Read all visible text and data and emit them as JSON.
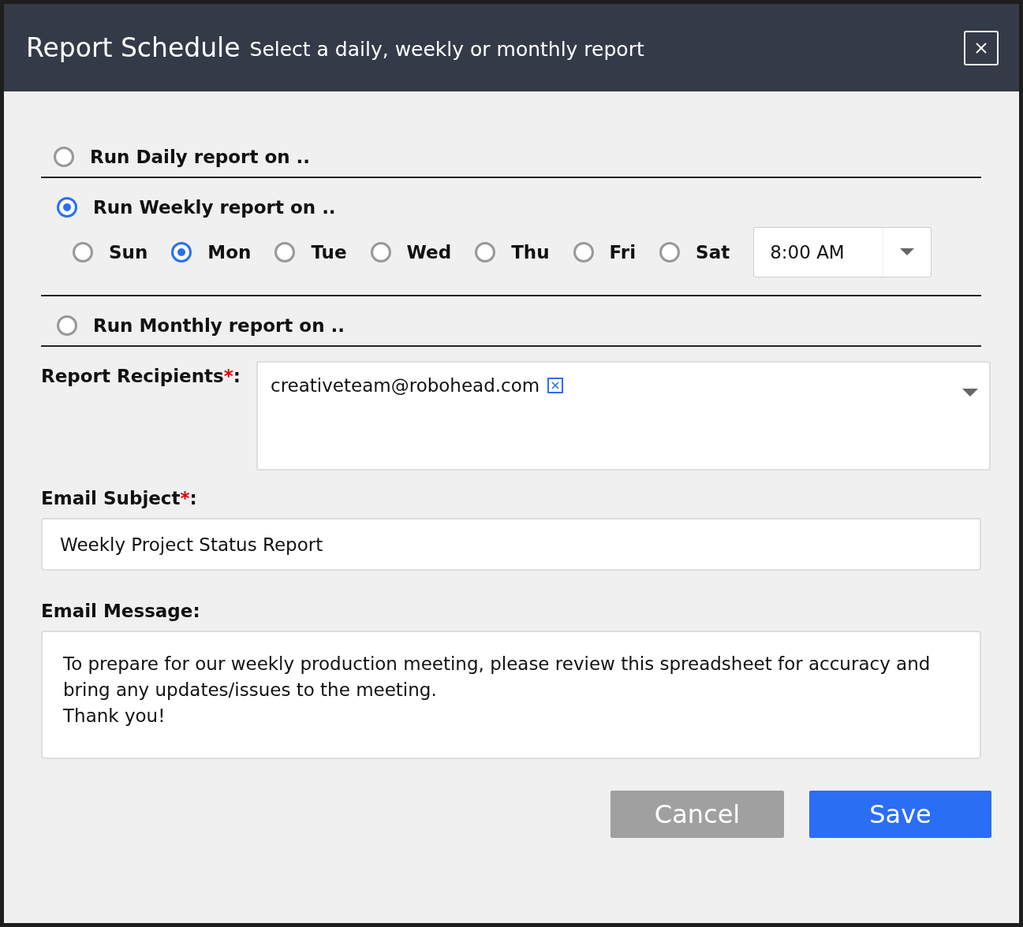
{
  "dialog": {
    "title": "Report Schedule",
    "subtitle": "Select a daily, weekly or monthly report"
  },
  "schedule_options": [
    {
      "label": "Run Daily report on ..",
      "selected": false
    },
    {
      "label": "Run Weekly report on ..",
      "selected": true,
      "days": [
        {
          "label": "Sun",
          "selected": false
        },
        {
          "label": "Mon",
          "selected": true
        },
        {
          "label": "Tue",
          "selected": false
        },
        {
          "label": "Wed",
          "selected": false
        },
        {
          "label": "Thu",
          "selected": false
        },
        {
          "label": "Fri",
          "selected": false
        },
        {
          "label": "Sat",
          "selected": false
        }
      ],
      "time": "8:00 AM"
    },
    {
      "label": "Run Monthly report on ..",
      "selected": false
    }
  ],
  "recipients": {
    "label": "Report Recipients",
    "required_mark": "*",
    "colon": ":",
    "tags": [
      {
        "text": "creativeteam@robohead.com"
      }
    ]
  },
  "subject": {
    "label": "Email Subject",
    "required_mark": "*",
    "colon": ":",
    "value": "Weekly Project Status Report"
  },
  "message": {
    "label": "Email Message:",
    "value": "To prepare for our weekly production meeting, please review this spreadsheet for accuracy and bring any updates/issues to the meeting.\nThank you!"
  },
  "buttons": [
    {
      "label": "Cancel",
      "kind": "secondary"
    },
    {
      "label": "Save",
      "kind": "primary"
    }
  ]
}
